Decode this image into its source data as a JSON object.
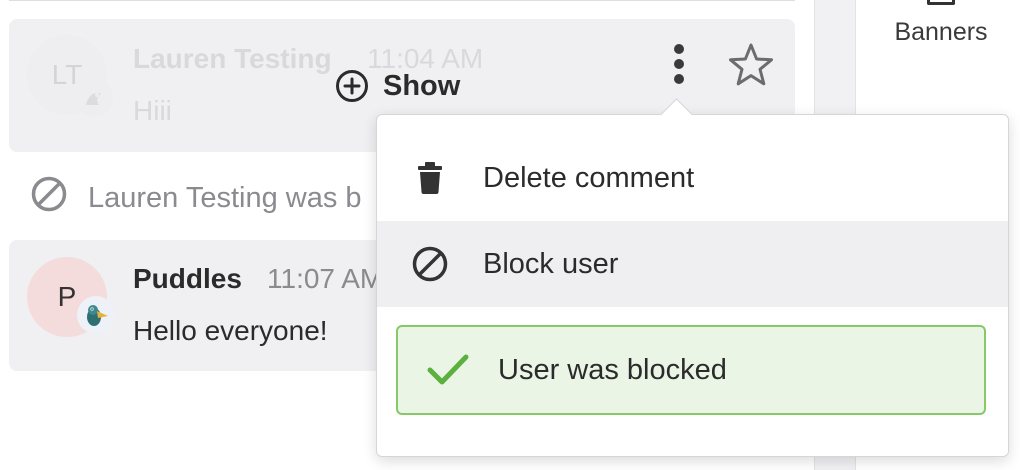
{
  "sidebar": {
    "banners_label": "Banners"
  },
  "hidden_comment": {
    "avatar_initials": "LT",
    "author": "Lauren Testing",
    "time": "11:04 AM",
    "body": "Hiii",
    "show_label": "Show"
  },
  "system_message": {
    "text": "Lauren Testing was b"
  },
  "visible_comment": {
    "avatar_initials": "P",
    "author": "Puddles",
    "time": "11:07 AM",
    "body": "Hello everyone!"
  },
  "menu": {
    "delete_label": "Delete comment",
    "block_label": "Block user",
    "toast_text": "User was blocked"
  },
  "colors": {
    "toast_bg": "#eaf5e6",
    "toast_border": "#86c96a",
    "check": "#5cb03e"
  }
}
